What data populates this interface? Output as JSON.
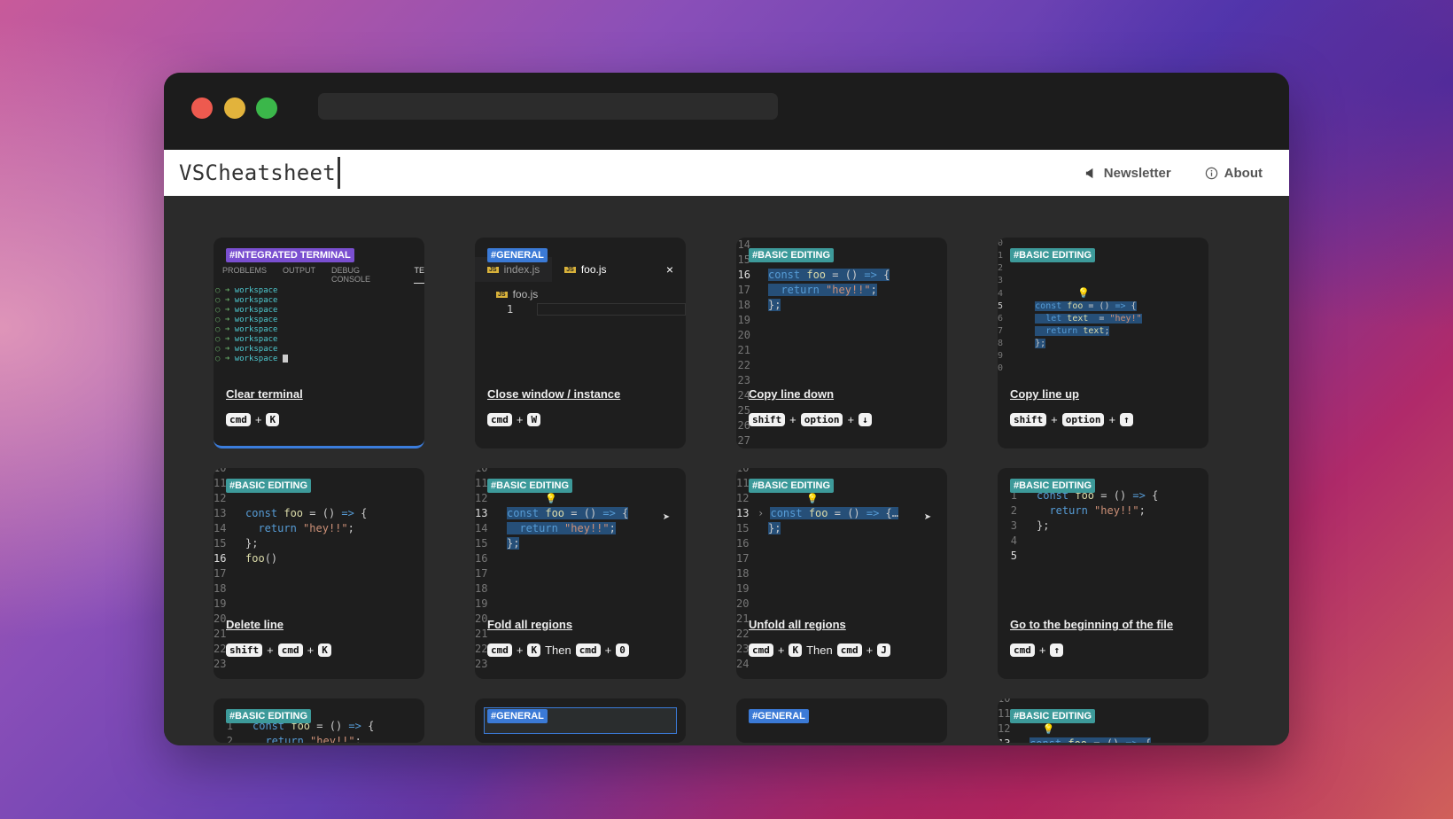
{
  "brand": "VSCheatsheet",
  "nav": {
    "newsletter": "Newsletter",
    "about": "About"
  },
  "cards": [
    {
      "tag": "#INTEGRATED TERMINAL",
      "title": "Clear terminal",
      "keys": [
        "cmd",
        "+",
        "K"
      ]
    },
    {
      "tag": "#GENERAL",
      "title": "Close window / instance",
      "keys": [
        "cmd",
        "+",
        "W"
      ],
      "tabs": [
        "index.js",
        "foo.js"
      ],
      "file": "foo.js"
    },
    {
      "tag": "#BASIC EDITING",
      "title": "Copy line down",
      "keys": [
        "shift",
        "+",
        "option",
        "+",
        "↓"
      ]
    },
    {
      "tag": "#BASIC EDITING",
      "title": "Copy line up",
      "keys": [
        "shift",
        "+",
        "option",
        "+",
        "↑"
      ]
    },
    {
      "tag": "#BASIC EDITING",
      "title": "Delete line",
      "keys": [
        "shift",
        "+",
        "cmd",
        "+",
        "K"
      ]
    },
    {
      "tag": "#BASIC EDITING",
      "title": "Fold all regions",
      "keys": [
        "cmd",
        "+",
        "K",
        "Then",
        "cmd",
        "+",
        "0"
      ]
    },
    {
      "tag": "#BASIC EDITING",
      "title": "Unfold all regions",
      "keys": [
        "cmd",
        "+",
        "K",
        "Then",
        "cmd",
        "+",
        "J"
      ]
    },
    {
      "tag": "#BASIC EDITING",
      "title": "Go to the beginning of the file",
      "keys": [
        "cmd",
        "+",
        "↑"
      ]
    },
    {
      "tag": "#BASIC EDITING"
    },
    {
      "tag": "#GENERAL"
    },
    {
      "tag": "#GENERAL"
    },
    {
      "tag": "#BASIC EDITING"
    }
  ],
  "terminal": {
    "tabs": [
      "PROBLEMS",
      "OUTPUT",
      "DEBUG CONSOLE",
      "TE"
    ],
    "line": "workspace"
  },
  "colors": {
    "purple_tag": "#7a4fd0",
    "blue_tag": "#3b7ad6",
    "teal_tag": "#3d9a9a"
  }
}
